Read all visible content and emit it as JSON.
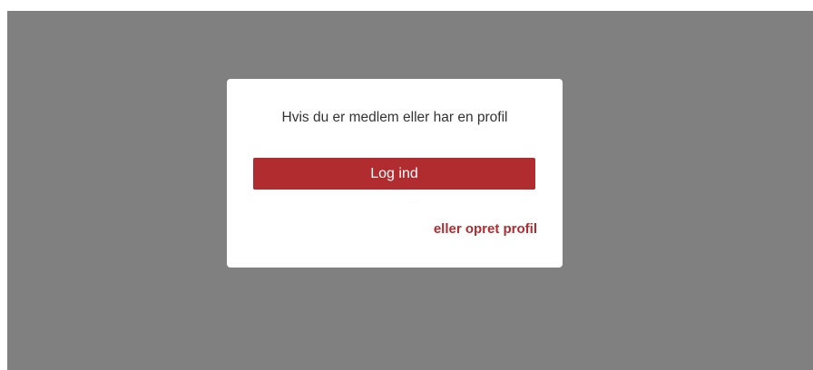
{
  "dialog": {
    "prompt": "Hvis du er medlem eller har en profil",
    "login_label": "Log ind",
    "create_profile_label": "eller opret profil"
  },
  "colors": {
    "overlay": "#808080",
    "accent": "#b12c2e",
    "dialog_bg": "#ffffff"
  }
}
